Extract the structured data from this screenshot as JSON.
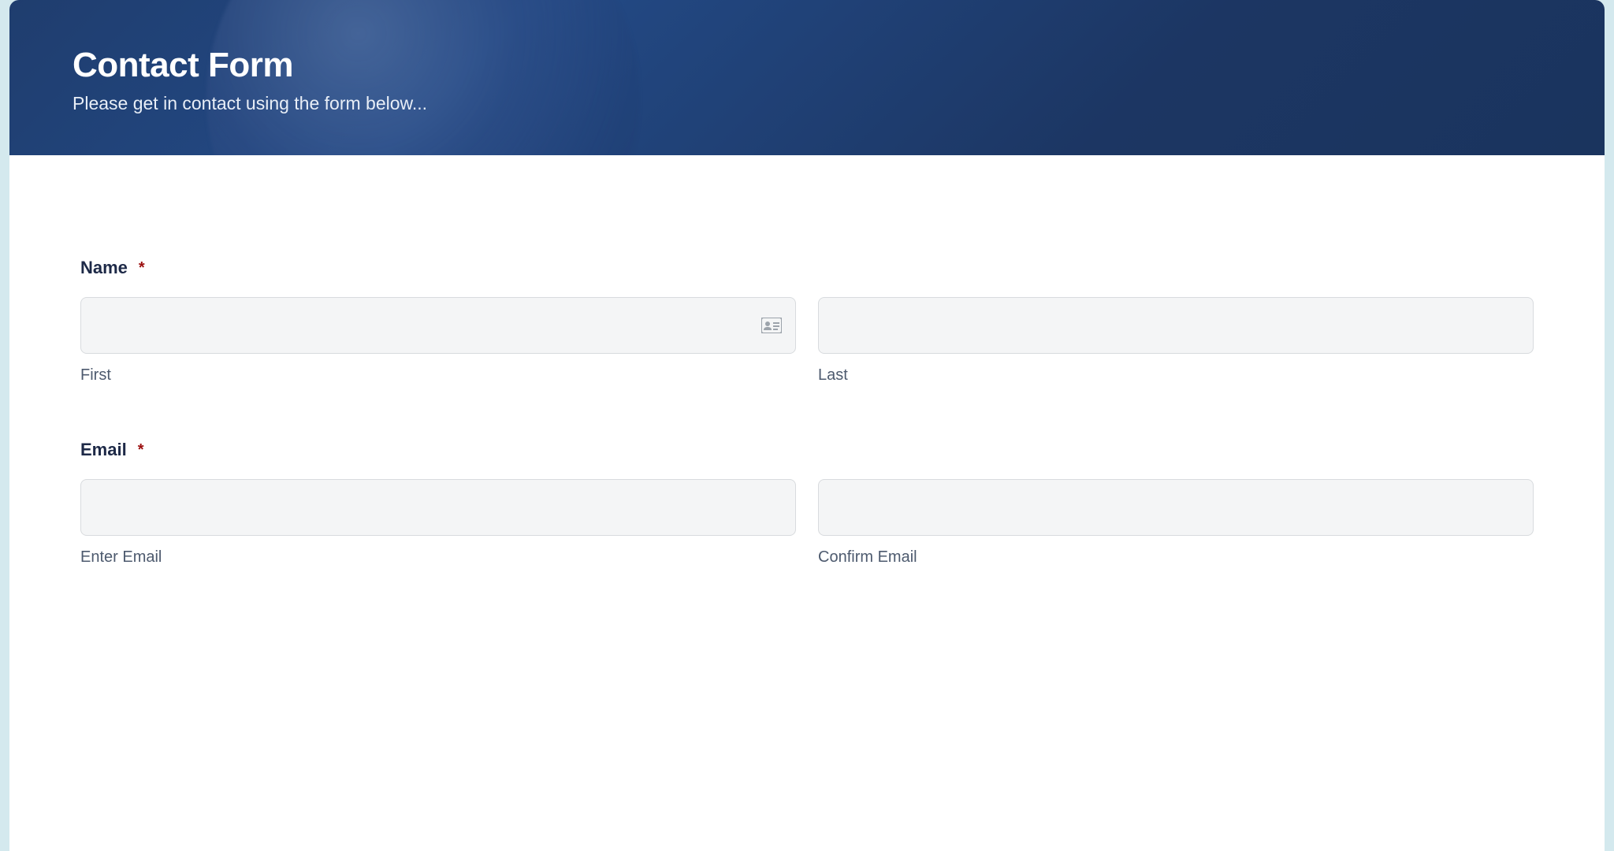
{
  "header": {
    "title": "Contact Form",
    "subtitle": "Please get in contact using the form below..."
  },
  "form": {
    "name": {
      "label": "Name",
      "required": "*",
      "first": {
        "sublabel": "First",
        "value": ""
      },
      "last": {
        "sublabel": "Last",
        "value": ""
      }
    },
    "email": {
      "label": "Email",
      "required": "*",
      "enter": {
        "sublabel": "Enter Email",
        "value": ""
      },
      "confirm": {
        "sublabel": "Confirm Email",
        "value": ""
      }
    }
  }
}
